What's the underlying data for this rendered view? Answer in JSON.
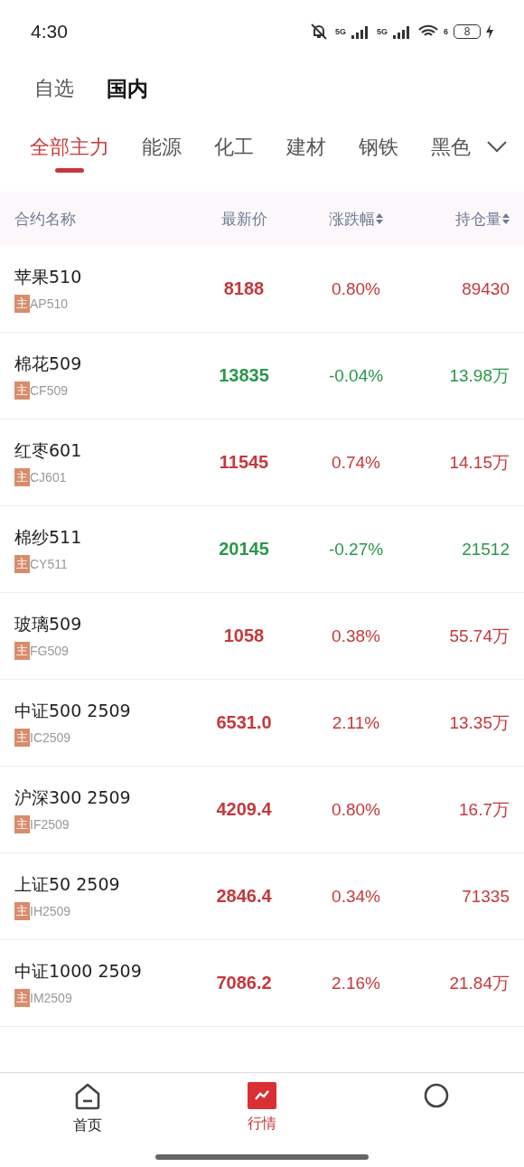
{
  "status_bar": {
    "time": "4:30",
    "network_1": "5G",
    "network_2": "5G",
    "wifi_badge": "6",
    "battery": "8"
  },
  "top_tabs": [
    {
      "label": "自选",
      "selected": false
    },
    {
      "label": "国内",
      "selected": true
    }
  ],
  "category_tabs": [
    {
      "label": "全部主力",
      "selected": true
    },
    {
      "label": "能源",
      "selected": false
    },
    {
      "label": "化工",
      "selected": false
    },
    {
      "label": "建材",
      "selected": false
    },
    {
      "label": "钢铁",
      "selected": false
    },
    {
      "label": "黑色",
      "selected": false
    }
  ],
  "table": {
    "columns": [
      {
        "label": "合约名称",
        "sortable": false
      },
      {
        "label": "最新价",
        "sortable": false
      },
      {
        "label": "涨跌幅",
        "sortable": true
      },
      {
        "label": "持仓量",
        "sortable": true
      }
    ],
    "rows": [
      {
        "name": "苹果510",
        "tag": "主",
        "code": "AP510",
        "price": "8188",
        "change": "0.80%",
        "open_interest": "89430",
        "kind": "up"
      },
      {
        "name": "棉花509",
        "tag": "主",
        "code": "CF509",
        "price": "13835",
        "change": "-0.04%",
        "open_interest": "13.98万",
        "kind": "down"
      },
      {
        "name": "红枣601",
        "tag": "主",
        "code": "CJ601",
        "price": "11545",
        "change": "0.74%",
        "open_interest": "14.15万",
        "kind": "up"
      },
      {
        "name": "棉纱511",
        "tag": "主",
        "code": "CY511",
        "price": "20145",
        "change": "-0.27%",
        "open_interest": "21512",
        "kind": "down"
      },
      {
        "name": "玻璃509",
        "tag": "主",
        "code": "FG509",
        "price": "1058",
        "change": "0.38%",
        "open_interest": "55.74万",
        "kind": "up"
      },
      {
        "name": "中证500 2509",
        "tag": "主",
        "code": "IC2509",
        "price": "6531.0",
        "change": "2.11%",
        "open_interest": "13.35万",
        "kind": "up"
      },
      {
        "name": "沪深300 2509",
        "tag": "主",
        "code": "IF2509",
        "price": "4209.4",
        "change": "0.80%",
        "open_interest": "16.7万",
        "kind": "up"
      },
      {
        "name": "上证50 2509",
        "tag": "主",
        "code": "IH2509",
        "price": "2846.4",
        "change": "0.34%",
        "open_interest": "71335",
        "kind": "up"
      },
      {
        "name": "中证1000 2509",
        "tag": "主",
        "code": "IM2509",
        "price": "7086.2",
        "change": "2.16%",
        "open_interest": "21.84万",
        "kind": "up"
      }
    ]
  },
  "bottom_nav": [
    {
      "label": "首页",
      "kind": "home",
      "selected": false
    },
    {
      "label": "行情",
      "kind": "chart",
      "selected": true
    },
    {
      "kind": "other",
      "selected": false
    }
  ]
}
